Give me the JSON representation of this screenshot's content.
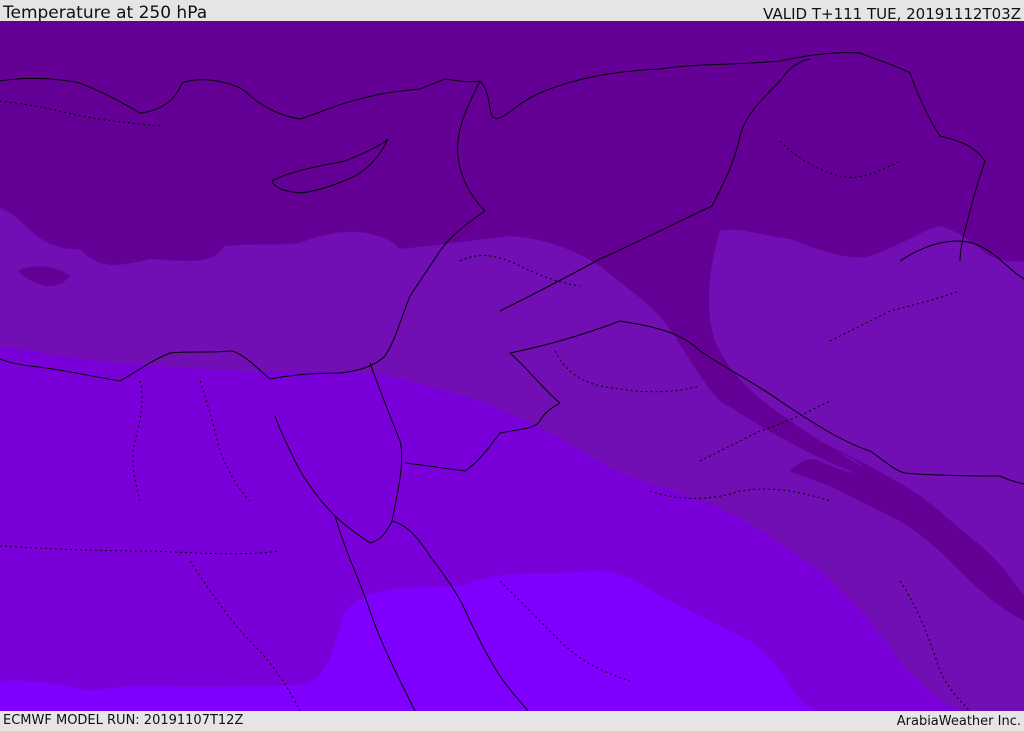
{
  "header": {
    "title": "Temperature at 250 hPa",
    "valid": "VALID T+111 TUE, 20191112T03Z"
  },
  "footer": {
    "model_run": "ECMWF MODEL RUN: 20191107T12Z",
    "credit": "ArabiaWeather Inc."
  },
  "colors": {
    "band_coldest": "#650096",
    "band_cold": "#720fb4",
    "band_mid": "#7a00da",
    "band_warm": "#7f00ff",
    "border_line": "#000000"
  }
}
